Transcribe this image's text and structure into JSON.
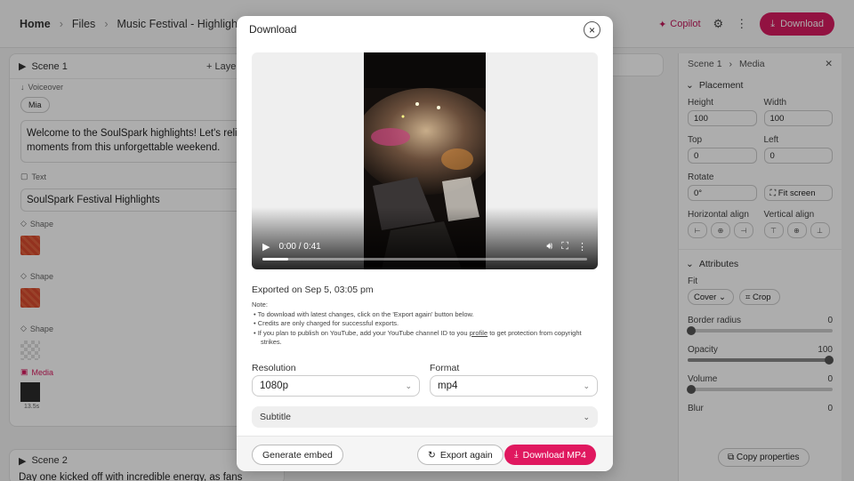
{
  "topbar": {
    "home": "Home",
    "files": "Files",
    "project": "Music Festival - Highlight Reel",
    "copilot": "Copilot",
    "download": "Download"
  },
  "left": {
    "scene1": "Scene 1",
    "add_layer": "Layer",
    "voiceover_label": "Voiceover",
    "voice_chip": "Mia",
    "voiceover_text": "Welcome to the SoulSpark highlights! Let's relive t moments from this unforgettable weekend.",
    "text_label": "Text",
    "text_value": "SoulSpark Festival Highlights",
    "shape_label": "Shape",
    "media_label": "Media",
    "media_duration": "13.5s",
    "scene2": "Scene 2",
    "scene2_text": "Day one kicked off with incredible energy, as fans"
  },
  "right": {
    "crumb_scene": "Scene 1",
    "crumb_media": "Media",
    "placement": "Placement",
    "height_label": "Height",
    "height": "100",
    "width_label": "Width",
    "width": "100",
    "top_label": "Top",
    "top": "0",
    "left_label": "Left",
    "left": "0",
    "rotate_label": "Rotate",
    "rotate": "0°",
    "fit_screen": "Fit screen",
    "h_align": "Horizontal align",
    "v_align": "Vertical align",
    "attributes": "Attributes",
    "fit_label": "Fit",
    "fit_value": "Cover",
    "crop": "Crop",
    "border_radius": "Border radius",
    "border_radius_value": "0",
    "opacity": "Opacity",
    "opacity_value": "100",
    "volume": "Volume",
    "volume_value": "0",
    "blur": "Blur",
    "blur_value": "0",
    "copy_properties": "Copy properties"
  },
  "modal": {
    "title": "Download",
    "time": "0:00 / 0:41",
    "playback_progress": 0.08,
    "exported": "Exported on Sep 5, 03:05 pm",
    "note_title": "Note:",
    "note1": "To download with latest changes, click on the 'Export again' button below.",
    "note2": "Credits are only charged for successful exports.",
    "note3a": "If you plan to publish on YouTube, add your YouTube channel ID to you",
    "note3_link": "profile",
    "note3b": "to get protection from copyright strikes.",
    "resolution_label": "Resolution",
    "resolution": "1080p",
    "format_label": "Format",
    "format": "mp4",
    "subtitle": "Subtitle",
    "generate_embed": "Generate embed",
    "export_again": "Export again",
    "download_mp4": "Download MP4"
  },
  "colors": {
    "accent": "#e0185f",
    "overlay": "rgba(0,0,0,0.32)"
  }
}
